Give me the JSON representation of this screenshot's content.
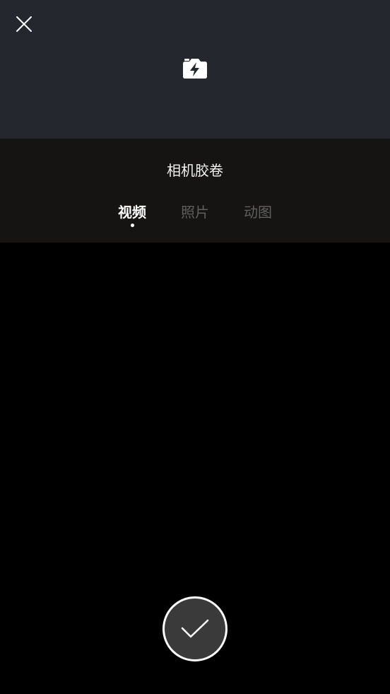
{
  "header": {
    "close_icon": "close-icon",
    "flash_icon": "camera-flash-icon"
  },
  "camera_roll": {
    "title": "相机胶卷",
    "tabs": [
      {
        "label": "视频",
        "active": true
      },
      {
        "label": "照片",
        "active": false
      },
      {
        "label": "动图",
        "active": false
      }
    ]
  },
  "confirm": {
    "icon": "checkmark-icon"
  },
  "colors": {
    "top_bar": "#24272d",
    "panel": "#151413",
    "background": "#000000",
    "tab_active": "#ffffff",
    "tab_inactive": "#5f5f5f",
    "confirm_fill": "#3a3a3a"
  }
}
